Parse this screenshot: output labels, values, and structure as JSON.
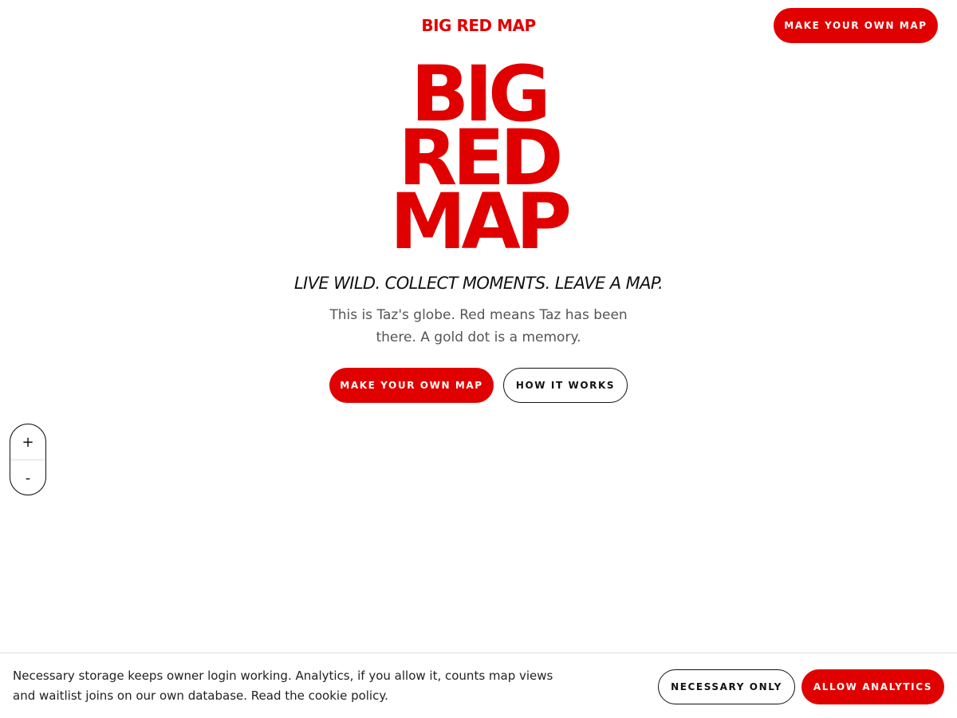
{
  "header": {
    "brand": "BIG RED MAP",
    "cta_label": "MAKE YOUR OWN MAP"
  },
  "hero": {
    "title_lines": [
      "BIG",
      "RED",
      "MAP"
    ],
    "tagline": "LIVE WILD. COLLECT MOMENTS. LEAVE A MAP.",
    "intro": "This is Taz's globe. Red means Taz has been there. A gold dot is a memory.",
    "primary_cta": "MAKE YOUR OWN MAP",
    "secondary_cta": "HOW IT WORKS"
  },
  "map_controls": {
    "zoom_in_label": "+",
    "zoom_out_label": "-"
  },
  "cookie_banner": {
    "text": "Necessary storage keeps owner login working. Analytics, if you allow it, counts map views and waitlist joins on our own database. Read the cookie policy.",
    "necessary_label": "NECESSARY ONLY",
    "allow_label": "ALLOW ANALYTICS"
  },
  "colors": {
    "accent": "#e00000",
    "text": "#111111",
    "muted": "#555555",
    "background": "#ffffff"
  }
}
